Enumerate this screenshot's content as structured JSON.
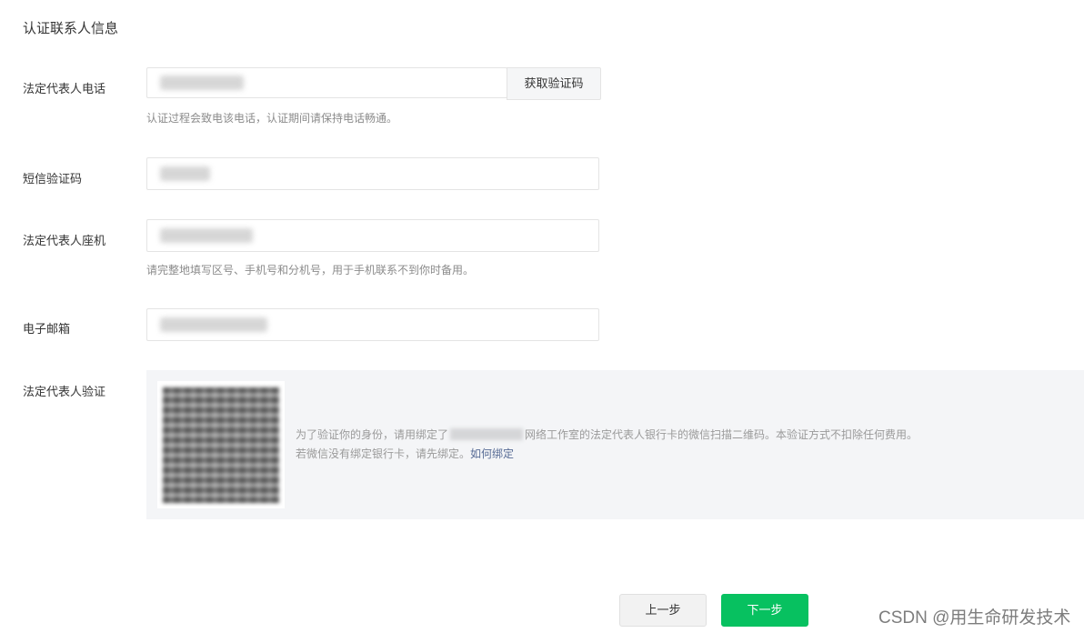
{
  "section_title": "认证联系人信息",
  "fields": {
    "phone": {
      "label": "法定代表人电话",
      "get_code_label": "获取验证码",
      "hint": "认证过程会致电该电话，认证期间请保持电话畅通。"
    },
    "sms_code": {
      "label": "短信验证码"
    },
    "landline": {
      "label": "法定代表人座机",
      "hint": "请完整地填写区号、手机号和分机号，用于手机联系不到你时备用。"
    },
    "email": {
      "label": "电子邮箱"
    }
  },
  "verification": {
    "label": "法定代表人验证",
    "text_before": "为了验证你的身份，请用绑定了",
    "text_after": "网络工作室的法定代表人银行卡的微信扫描二维码。本验证方式不扣除任何费用。",
    "line2": "若微信没有绑定银行卡，请先绑定。",
    "link_label": "如何绑定"
  },
  "buttons": {
    "prev": "上一步",
    "next": "下一步"
  },
  "watermark": "CSDN @用生命研发技术",
  "colors": {
    "primary": "#07c160",
    "link": "#576b95"
  }
}
